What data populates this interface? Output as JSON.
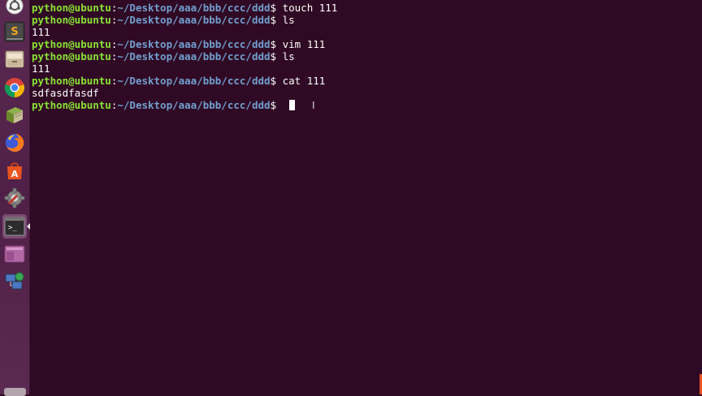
{
  "launcher": {
    "items": [
      {
        "name": "dash-home-icon"
      },
      {
        "name": "sublime-text-icon"
      },
      {
        "name": "files-icon"
      },
      {
        "name": "chrome-icon"
      },
      {
        "name": "book-reader-icon"
      },
      {
        "name": "firefox-icon"
      },
      {
        "name": "software-center-icon"
      },
      {
        "name": "system-settings-icon"
      },
      {
        "name": "terminal-icon",
        "active": true
      },
      {
        "name": "workspace-switcher-icon"
      },
      {
        "name": "network-icon"
      }
    ]
  },
  "terminal": {
    "prompt_user": "python@ubuntu",
    "prompt_path": "~/Desktop/aaa/bbb/ccc/ddd",
    "prompt_symbol": "$",
    "lines": [
      {
        "type": "prompt",
        "command": " touch 111"
      },
      {
        "type": "prompt",
        "command": " ls"
      },
      {
        "type": "output",
        "text": "111"
      },
      {
        "type": "prompt",
        "command": " vim 111"
      },
      {
        "type": "prompt",
        "command": " ls"
      },
      {
        "type": "output",
        "text": "111"
      },
      {
        "type": "prompt",
        "command": " cat 111"
      },
      {
        "type": "output",
        "text": "sdfasdfasdf"
      },
      {
        "type": "prompt",
        "command": " "
      }
    ]
  },
  "colors": {
    "background": "#300a24",
    "user": "#8ae234",
    "path": "#729fcf",
    "text": "#ffffff"
  }
}
